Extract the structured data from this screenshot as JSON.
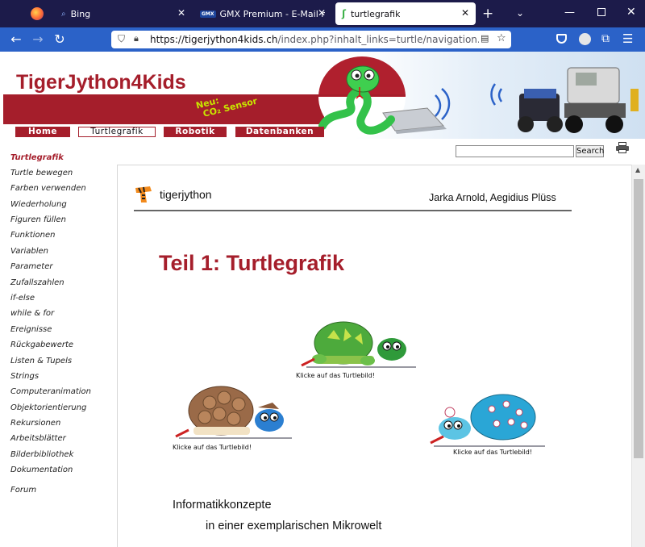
{
  "browser": {
    "tabs": [
      {
        "label": "Bing",
        "active": false
      },
      {
        "label": "GMX Premium - E-Mail made in Germany",
        "active": false
      },
      {
        "label": "turtlegrafik",
        "active": true
      }
    ],
    "url_host": "https://tigerjython4kids.ch",
    "url_path": "/index.php?inhalt_links=turtle/navigation.inc.php&inhalt_mitte=turtle/turtlegrafik.html",
    "gmx_badge": "GMX"
  },
  "site": {
    "title": "TigerJython4Kids",
    "sensor_line1": "Neu:",
    "sensor_line2": "CO₂ Sensor",
    "menu": [
      {
        "label": "Home",
        "active": false
      },
      {
        "label": "Turtlegrafik",
        "active": true
      },
      {
        "label": "Robotik",
        "active": false
      },
      {
        "label": "Datenbanken",
        "active": false
      }
    ],
    "search_button": "Search"
  },
  "sidebar": {
    "items": [
      "Turtlegrafik",
      "Turtle bewegen",
      "Farben verwenden",
      "Wiederholung",
      "Figuren füllen",
      "Funktionen",
      "Variablen",
      "Parameter",
      "Zufallszahlen",
      "if-else",
      "while & for",
      "Ereignisse",
      "Rückgabewerte",
      "Listen & Tupels",
      "Strings",
      "Computeranimation",
      "Objektorientierung",
      "Rekursionen",
      "Arbeitsblätter",
      "Bilderbibliothek",
      "Dokumentation",
      "Forum"
    ]
  },
  "content": {
    "logo_text": "tigerjython",
    "authors": "Jarka Arnold, Aegidius Plüss",
    "heading": "Teil 1: Turtlegrafik",
    "caption1": "Klicke auf das Turtlebild!",
    "caption2": "Klicke auf das Turtlebild!",
    "caption3": "Klicke auf das Turtlebild!",
    "concept1": "Informatikkonzepte",
    "concept2": "in einer exemplarischen Mikrowelt"
  },
  "colors": {
    "brand_red": "#a51e2b",
    "browser_blue": "#2b62c8",
    "tab_dark": "#1c1b4a"
  }
}
